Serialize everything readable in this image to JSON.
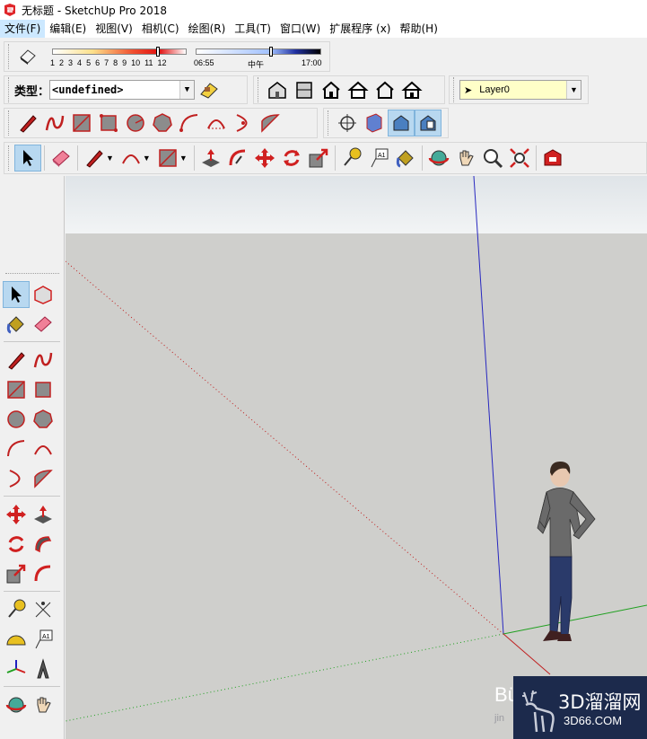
{
  "window": {
    "title": "无标题 - SketchUp Pro 2018"
  },
  "menu": {
    "items": [
      "文件(F)",
      "编辑(E)",
      "视图(V)",
      "相机(C)",
      "绘图(R)",
      "工具(T)",
      "窗口(W)",
      "扩展程序 (x)",
      "帮助(H)"
    ]
  },
  "shadow": {
    "month_ticks": [
      "1",
      "2",
      "3",
      "4",
      "5",
      "6",
      "7",
      "8",
      "9",
      "10",
      "11",
      "12"
    ],
    "time_start": "06:55",
    "time_mid": "中午",
    "time_end": "17:00"
  },
  "entity": {
    "type_label": "类型：",
    "type_value": "<undefined>"
  },
  "layer": {
    "name": "Layer0"
  },
  "colors": {
    "red_axis": "#cc2020",
    "green_axis": "#20a020",
    "blue_axis": "#2020c0",
    "sky": "#e6ebee",
    "ground": "#cfcfcc"
  },
  "watermark": {
    "text_main": "3D溜溜网",
    "text_sub": "3D66.COM"
  },
  "person_label": "Bü",
  "jin_label": "jin"
}
